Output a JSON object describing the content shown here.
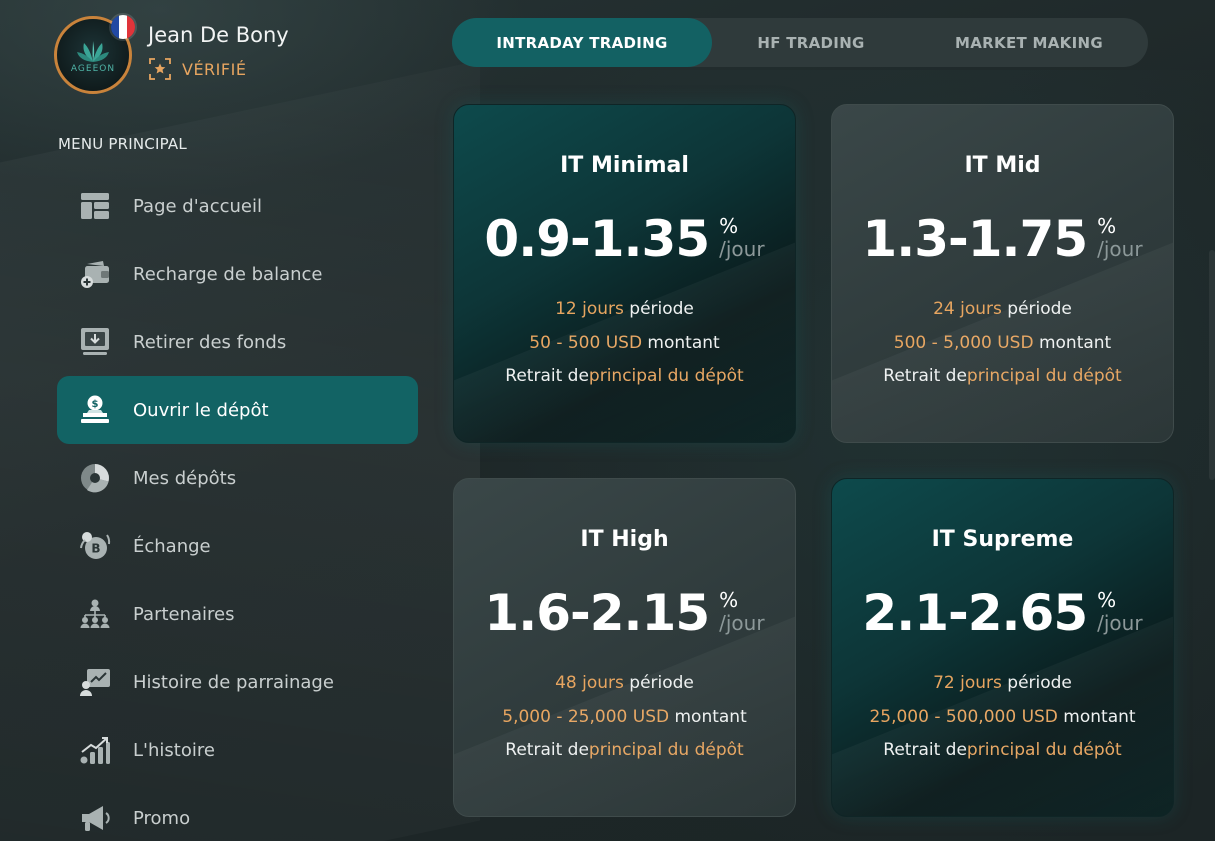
{
  "profile": {
    "name": "Jean De Bony",
    "status": "VÉRIFIÉ",
    "logo_text": "AGEEON",
    "accent_color": "#e7a560",
    "flag_colors": [
      "#2249a3",
      "#ffffff",
      "#e0343a"
    ]
  },
  "sidebar": {
    "menu_title": "MENU PRINCIPAL",
    "items": [
      {
        "label": "Page d'accueil",
        "icon": "dashboard-icon"
      },
      {
        "label": "Recharge de balance",
        "icon": "wallet-add-icon"
      },
      {
        "label": "Retirer des fonds",
        "icon": "withdraw-icon"
      },
      {
        "label": "Ouvrir le dépôt",
        "icon": "deposit-icon",
        "active": true
      },
      {
        "label": "Mes dépôts",
        "icon": "pie-chart-icon"
      },
      {
        "label": "Échange",
        "icon": "exchange-coin-icon"
      },
      {
        "label": "Partenaires",
        "icon": "partners-icon"
      },
      {
        "label": "Histoire de parrainage",
        "icon": "referral-history-icon"
      },
      {
        "label": "L'histoire",
        "icon": "history-chart-icon"
      },
      {
        "label": "Promo",
        "icon": "megaphone-icon"
      }
    ],
    "active_color": "#126364"
  },
  "tabs": [
    {
      "label": "INTRADAY TRADING",
      "active": true
    },
    {
      "label": "HF TRADING",
      "active": false
    },
    {
      "label": "MARKET MAKING",
      "active": false
    }
  ],
  "plans": [
    {
      "title": "IT Minimal",
      "rate": "0.9-1.35",
      "rate_pct": "%",
      "rate_per": "/jour",
      "days": "12 jours",
      "days_label": " période",
      "amount": "50 - 500 USD",
      "amount_label": " montant",
      "withdraw_label": "Retrait de",
      "withdraw_value": "principal du dépôt",
      "featured": true
    },
    {
      "title": "IT Mid",
      "rate": "1.3-1.75",
      "rate_pct": "%",
      "rate_per": "/jour",
      "days": "24 jours",
      "days_label": " période",
      "amount": "500 - 5,000 USD",
      "amount_label": " montant",
      "withdraw_label": "Retrait de",
      "withdraw_value": "principal du dépôt",
      "featured": false
    },
    {
      "title": "IT High",
      "rate": "1.6-2.15",
      "rate_pct": "%",
      "rate_per": "/jour",
      "days": "48 jours",
      "days_label": " période",
      "amount": "5,000 - 25,000 USD",
      "amount_label": " montant",
      "withdraw_label": "Retrait de",
      "withdraw_value": "principal du dépôt",
      "featured": false
    },
    {
      "title": "IT Supreme",
      "rate": "2.1-2.65",
      "rate_pct": "%",
      "rate_per": "/jour",
      "days": "72 jours",
      "days_label": " période",
      "amount": "25,000 - 500,000 USD",
      "amount_label": " montant",
      "withdraw_label": "Retrait de",
      "withdraw_value": "principal du dépôt",
      "featured": true
    }
  ]
}
